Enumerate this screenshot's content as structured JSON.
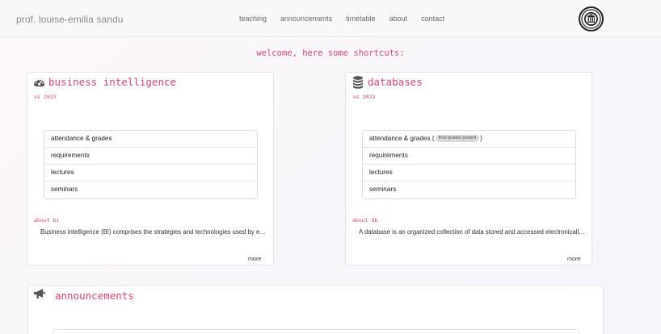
{
  "navbar": {
    "brand": "prof. louise-emilia sandu",
    "links": [
      "teaching",
      "announcements",
      "timetable",
      "about",
      "contact"
    ]
  },
  "welcome": "welcome, here some shortcuts:",
  "courses": [
    {
      "icon": "dashboard-icon",
      "title": "business intelligence",
      "semester": "ss 2023",
      "items": [
        "attendance & grades",
        "requirements",
        "lectures",
        "seminars"
      ],
      "about_label": "about bi",
      "about_text": "Business intelligence (BI) comprises the strategies and technologies used by enterprises for the data analysis of business information.",
      "more": "more"
    },
    {
      "icon": "database-icon",
      "title": "databases",
      "semester": "ws 2022",
      "items": [
        "attendance & grades",
        "requirements",
        "lectures",
        "seminars"
      ],
      "badge": "final grades posted",
      "about_label": "about db",
      "about_text": "A database is an organized collection of data stored and accessed electronically from a computer system.",
      "more": "more"
    }
  ],
  "announcements": {
    "icon": "megaphone-icon",
    "title": "announcements"
  },
  "colors": {
    "accent": "#d6407a",
    "navbar_bg": "#f8f8f8"
  }
}
